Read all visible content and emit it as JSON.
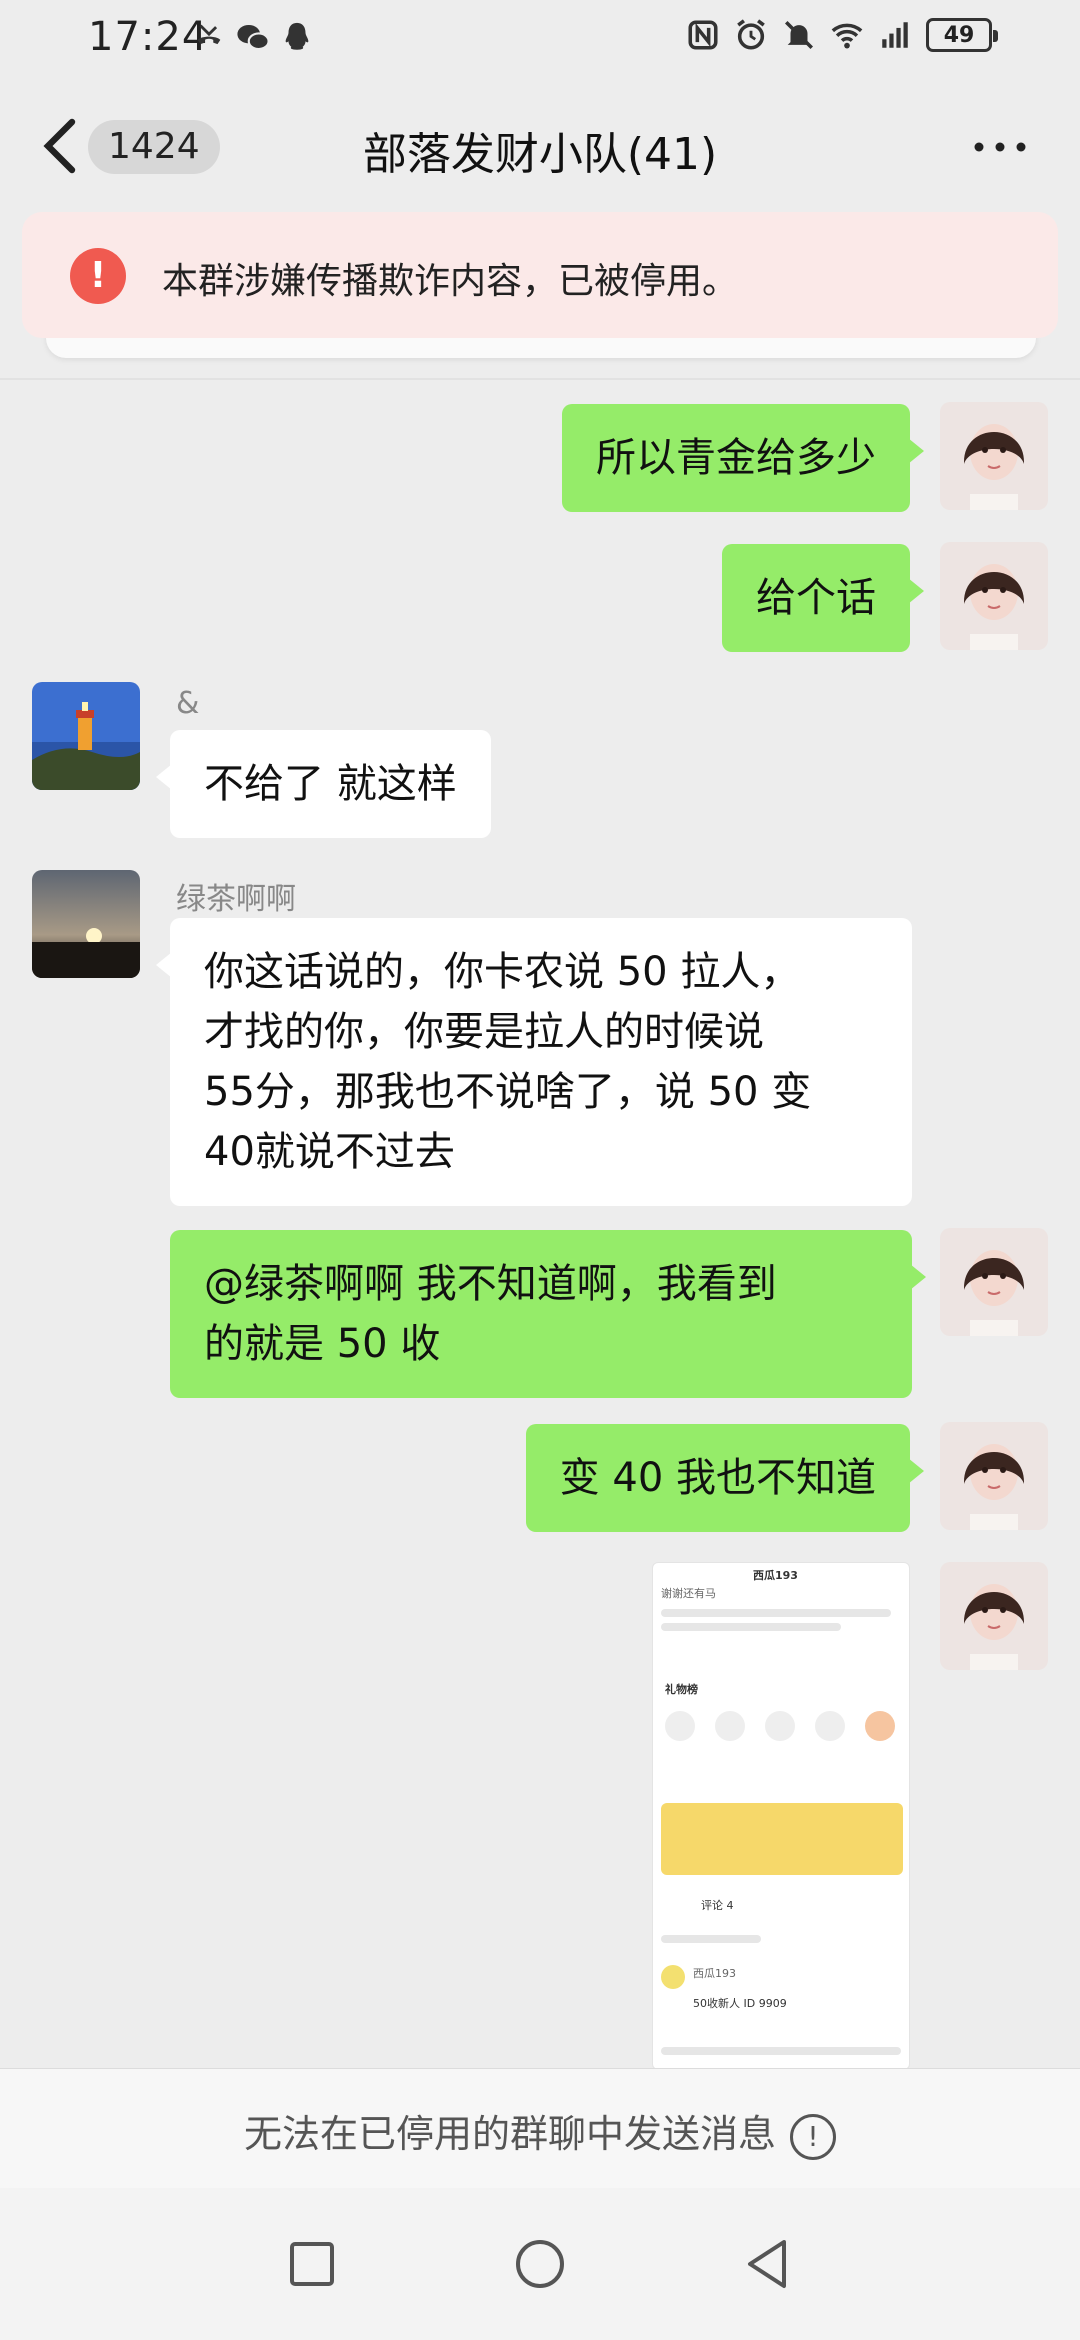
{
  "status_bar": {
    "time": "17:24",
    "battery": "49",
    "network": "4G"
  },
  "header": {
    "unread_count": "1424",
    "title": "部落发财小队(41)"
  },
  "banner": {
    "icon": "!",
    "text": "本群涉嫌传播欺诈内容，已被停用。"
  },
  "messages": [
    {
      "side": "right",
      "text": "所以青金给多少"
    },
    {
      "side": "right",
      "text": "给个话"
    },
    {
      "side": "left",
      "sender": "&",
      "text": "不给了 就这样"
    },
    {
      "side": "left",
      "sender": "绿茶啊啊",
      "lines": [
        "你这话说的，你卡农说 50 拉人，",
        "才找的你，你要是拉人的时候说",
        "55分，那我也不说啥了，说 50 变",
        "40就说不过去"
      ]
    },
    {
      "side": "right",
      "lines": [
        "@绿茶啊啊  我不知道啊，我看到",
        "的就是 50 收"
      ]
    },
    {
      "side": "right",
      "text": "变 40 我也不知道"
    },
    {
      "side": "right",
      "type": "image",
      "image_texts": {
        "title": "西瓜193",
        "subtitle": "谢谢还有马",
        "gift_header": "礼物榜",
        "comments": "评论 4",
        "comment_user": "西瓜193",
        "comment_text": "50收新人 ID 9909"
      }
    }
  ],
  "input": {
    "disabled_text": "无法在已停用的群聊中发送消息",
    "info_icon": "!"
  },
  "colors": {
    "bubble_self": "#95ec69",
    "bubble_other": "#ffffff",
    "background": "#ededed",
    "warning_red": "#f05a50"
  }
}
